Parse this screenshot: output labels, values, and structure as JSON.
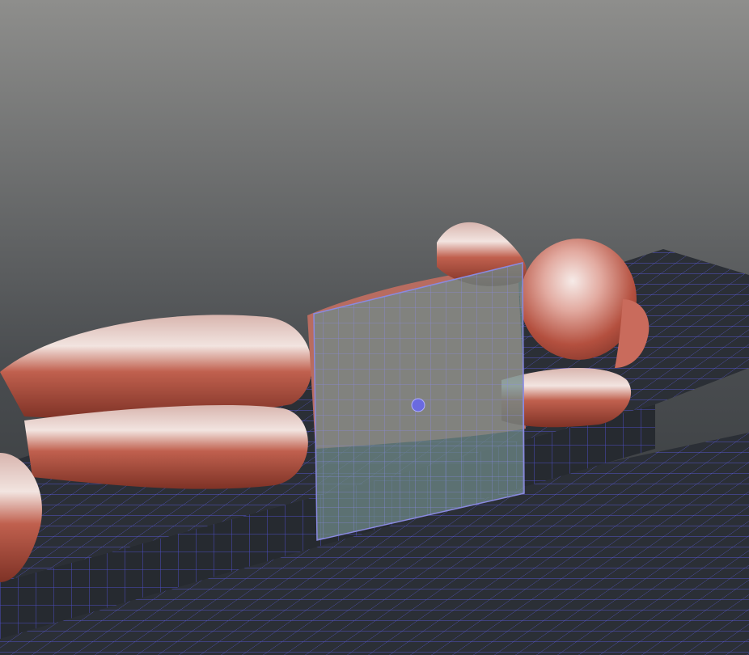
{
  "viewport": {
    "background_top_color": "#8e8e8c",
    "background_bottom_color": "#2f3336",
    "grid_color": "#5a5ad8",
    "grid_fill_color": "#2b2f36",
    "figure_color": "#c86a5a",
    "figure_highlight_color": "#f4e6e2",
    "plane_color": "#6f8a88",
    "plane_edge_color": "#8a8ae0",
    "handle_color": "#6a6ae0"
  },
  "objects": {
    "figure_icon": "mannequin-icon",
    "plane_icon": "section-plane-icon",
    "handle_icon": "transform-handle-icon"
  }
}
